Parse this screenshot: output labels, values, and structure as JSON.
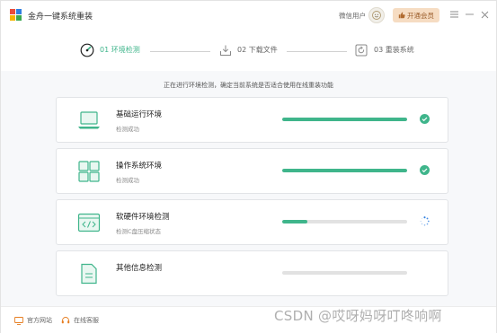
{
  "app": {
    "title": "金舟一键系统重装",
    "user": "微信用户",
    "vip_label": "开通会员",
    "logo_colors": [
      "#e94b3c",
      "#2f7fe0",
      "#f5b400",
      "#39a84f"
    ]
  },
  "steps": [
    {
      "label": "01 环境检测",
      "icon": "gauge-icon",
      "active": true
    },
    {
      "label": "02 下载文件",
      "icon": "download-icon",
      "active": false
    },
    {
      "label": "03 重装系统",
      "icon": "reinstall-icon",
      "active": false
    }
  ],
  "main": {
    "subtitle": "正在进行环境检测，确定当前系统是否适合使用在线重装功能",
    "cards": [
      {
        "title": "基础运行环境",
        "status": "检测成功",
        "icon": "laptop-icon",
        "progress": 1.0,
        "state": "done"
      },
      {
        "title": "操作系统环境",
        "status": "检测成功",
        "icon": "windows-grid-icon",
        "progress": 1.0,
        "state": "done"
      },
      {
        "title": "软硬件环境检测",
        "status": "检测C盘压缩状态",
        "icon": "code-window-icon",
        "progress": 0.2,
        "state": "loading"
      },
      {
        "title": "其他信息检测",
        "status": "",
        "icon": "document-icon",
        "progress": 0.0,
        "state": "pending"
      }
    ]
  },
  "footer": {
    "website": "官方网站",
    "support": "在线客服"
  },
  "watermark": "CSDN @哎呀妈呀叮咚响啊",
  "colors": {
    "accent": "#3fb58b",
    "icon": "#3fb58b",
    "vip_bg": "#f6dcc2"
  }
}
